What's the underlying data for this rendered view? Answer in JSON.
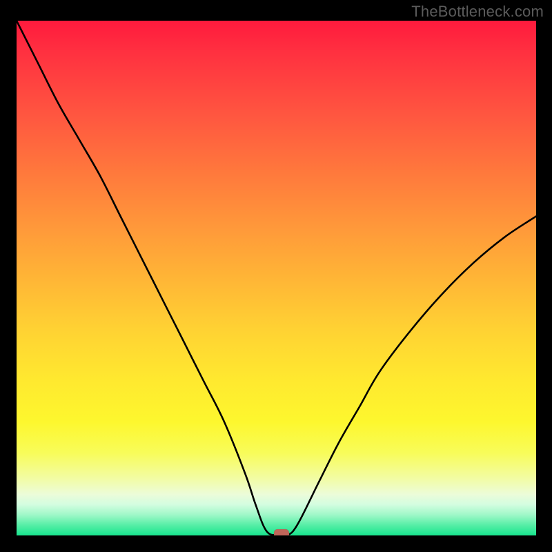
{
  "watermark": "TheBottleneck.com",
  "chart_data": {
    "type": "line",
    "title": "",
    "xlabel": "",
    "ylabel": "",
    "xlim": [
      0,
      100
    ],
    "ylim": [
      0,
      100
    ],
    "grid": false,
    "legend": false,
    "series": [
      {
        "name": "bottleneck-curve",
        "x": [
          0,
          4,
          8,
          12,
          16,
          20,
          24,
          28,
          32,
          36,
          40,
          44,
          46,
          48,
          50,
          52,
          54,
          58,
          62,
          66,
          70,
          76,
          82,
          88,
          94,
          100
        ],
        "values": [
          100,
          92,
          84,
          77,
          70,
          62,
          54,
          46,
          38,
          30,
          22,
          12,
          6,
          1,
          0,
          0,
          2,
          10,
          18,
          25,
          32,
          40,
          47,
          53,
          58,
          62
        ]
      }
    ],
    "marker": {
      "x": 51,
      "y": 0,
      "shape": "rounded-rect",
      "color": "#c0665a"
    },
    "background_gradient": {
      "stops": [
        {
          "pos": 0,
          "color": "#ff1a3d"
        },
        {
          "pos": 50,
          "color": "#ffd233"
        },
        {
          "pos": 100,
          "color": "#18e58e"
        }
      ]
    }
  }
}
